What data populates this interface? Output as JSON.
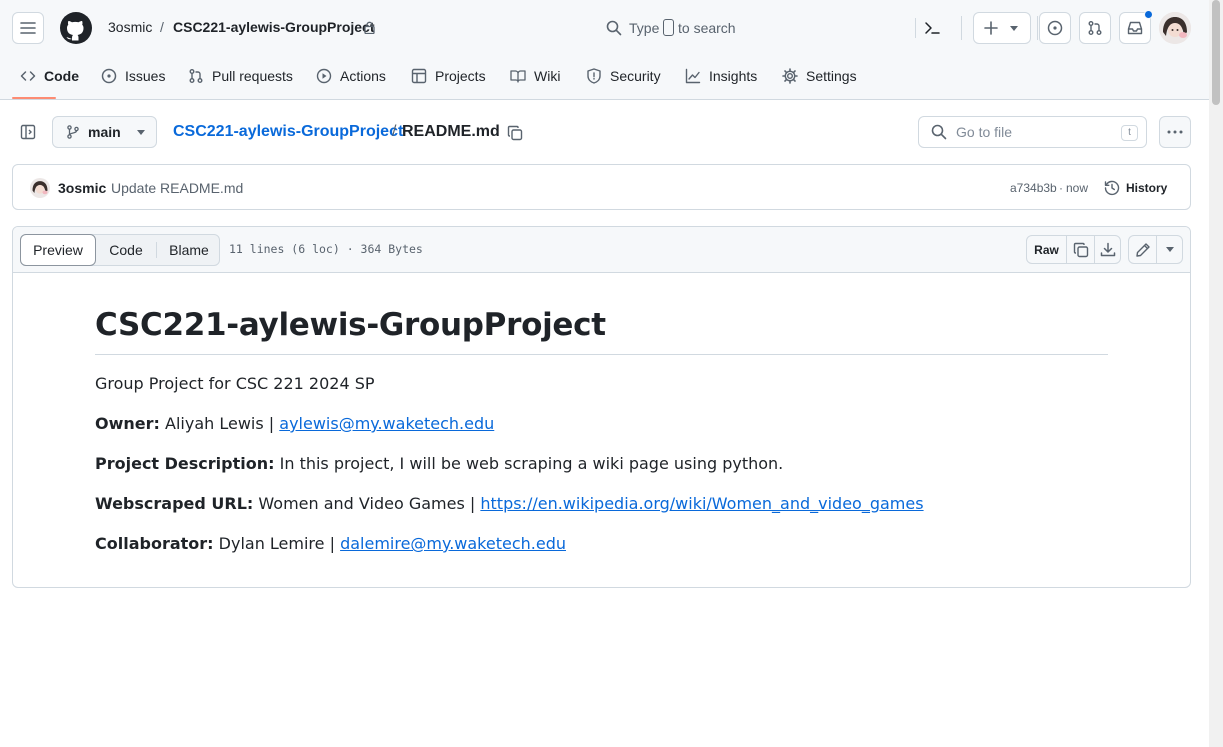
{
  "header": {
    "owner": "3osmic",
    "separator": "/",
    "repo": "CSC221-aylewis-GroupProject",
    "search_type": "Type",
    "search_key": "/",
    "search_rest": "to search"
  },
  "tabs": [
    {
      "label": "Code",
      "icon": "code-icon"
    },
    {
      "label": "Issues",
      "icon": "issue-icon"
    },
    {
      "label": "Pull requests",
      "icon": "pull-request-icon"
    },
    {
      "label": "Actions",
      "icon": "play-icon"
    },
    {
      "label": "Projects",
      "icon": "table-icon"
    },
    {
      "label": "Wiki",
      "icon": "book-icon"
    },
    {
      "label": "Security",
      "icon": "shield-icon"
    },
    {
      "label": "Insights",
      "icon": "graph-icon"
    },
    {
      "label": "Settings",
      "icon": "gear-icon"
    }
  ],
  "file_bar": {
    "branch": "main",
    "repo_link": "CSC221-aylewis-GroupProject",
    "separator": "/",
    "file_name": "README.md",
    "goto_placeholder": "Go to file",
    "goto_key": "t"
  },
  "commit": {
    "author": "3osmic",
    "message": "Update README.md",
    "sha": "a734b3b",
    "dot": "·",
    "time": "now",
    "history_label": "History"
  },
  "viewer": {
    "tabs": [
      "Preview",
      "Code",
      "Blame"
    ],
    "stats": "11 lines (6 loc) · 364 Bytes",
    "raw_label": "Raw"
  },
  "readme": {
    "title": "CSC221-aylewis-GroupProject",
    "subtitle": "Group Project for CSC 221 2024 SP",
    "owner_label": "Owner:",
    "owner_value": "Aliyah Lewis |",
    "owner_email": "aylewis@my.waketech.edu",
    "desc_label": "Project Description:",
    "desc_value": "In this project, I will be web scraping a wiki page using python.",
    "url_label": "Webscraped URL:",
    "url_value": "Women and Video Games |",
    "url_link": "https://en.wikipedia.org/wiki/Women_and_video_games",
    "collab_label": "Collaborator:",
    "collab_value": "Dylan Lemire |",
    "collab_email": "dalemire@my.waketech.edu"
  },
  "colors": {
    "accent": "#0969da",
    "tab_underline": "#fd8c73",
    "border": "#d1d9e0",
    "header_bg": "#f6f8fa"
  }
}
